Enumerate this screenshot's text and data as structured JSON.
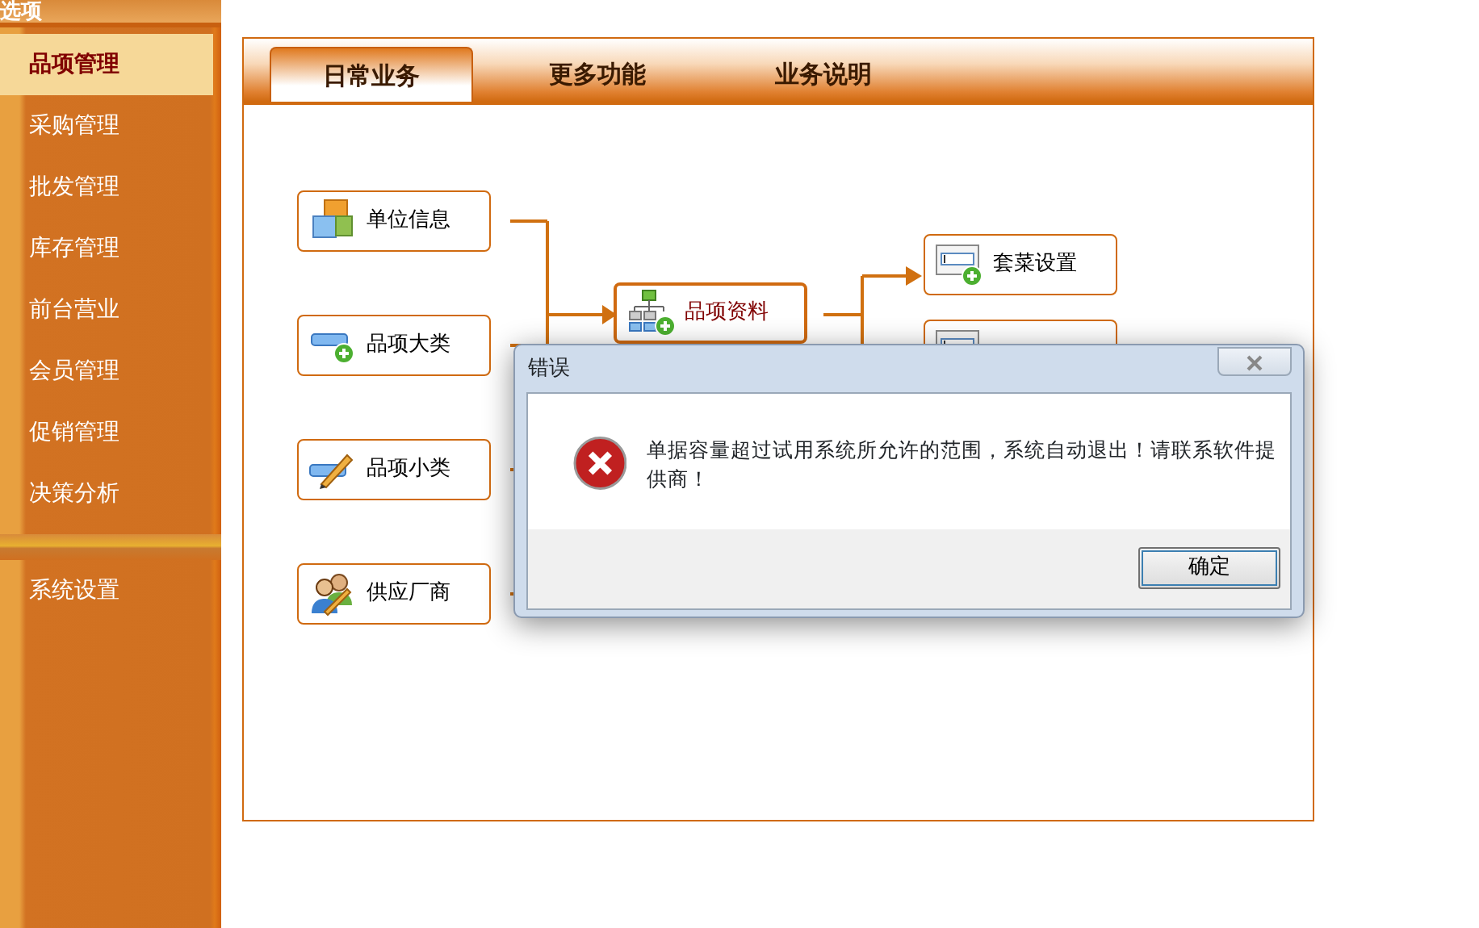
{
  "sidebar": {
    "header": "选项",
    "items": [
      {
        "label": "品项管理",
        "selected": true
      },
      {
        "label": "采购管理",
        "selected": false
      },
      {
        "label": "批发管理",
        "selected": false
      },
      {
        "label": "库存管理",
        "selected": false
      },
      {
        "label": "前台营业",
        "selected": false
      },
      {
        "label": "会员管理",
        "selected": false
      },
      {
        "label": "促销管理",
        "selected": false
      },
      {
        "label": "决策分析",
        "selected": false
      }
    ],
    "lower_items": [
      {
        "label": "系统设置",
        "selected": false
      }
    ]
  },
  "tabs": [
    {
      "label": "日常业务",
      "selected": true
    },
    {
      "label": "更多功能",
      "selected": false
    },
    {
      "label": "业务说明",
      "selected": false
    }
  ],
  "flow": {
    "sources": [
      {
        "label": "单位信息",
        "kind": "blocks"
      },
      {
        "label": "品项大类",
        "kind": "category"
      },
      {
        "label": "品项小类",
        "kind": "subcategory"
      },
      {
        "label": "供应厂商",
        "kind": "people"
      }
    ],
    "center": {
      "label": "品项资料"
    },
    "targets": [
      {
        "label": "套菜设置"
      }
    ]
  },
  "dialog": {
    "title": "错误",
    "message": "单据容量超过试用系统所允许的范围，系统自动退出！请联系软件提供商！",
    "buttons": [
      "确定"
    ]
  }
}
